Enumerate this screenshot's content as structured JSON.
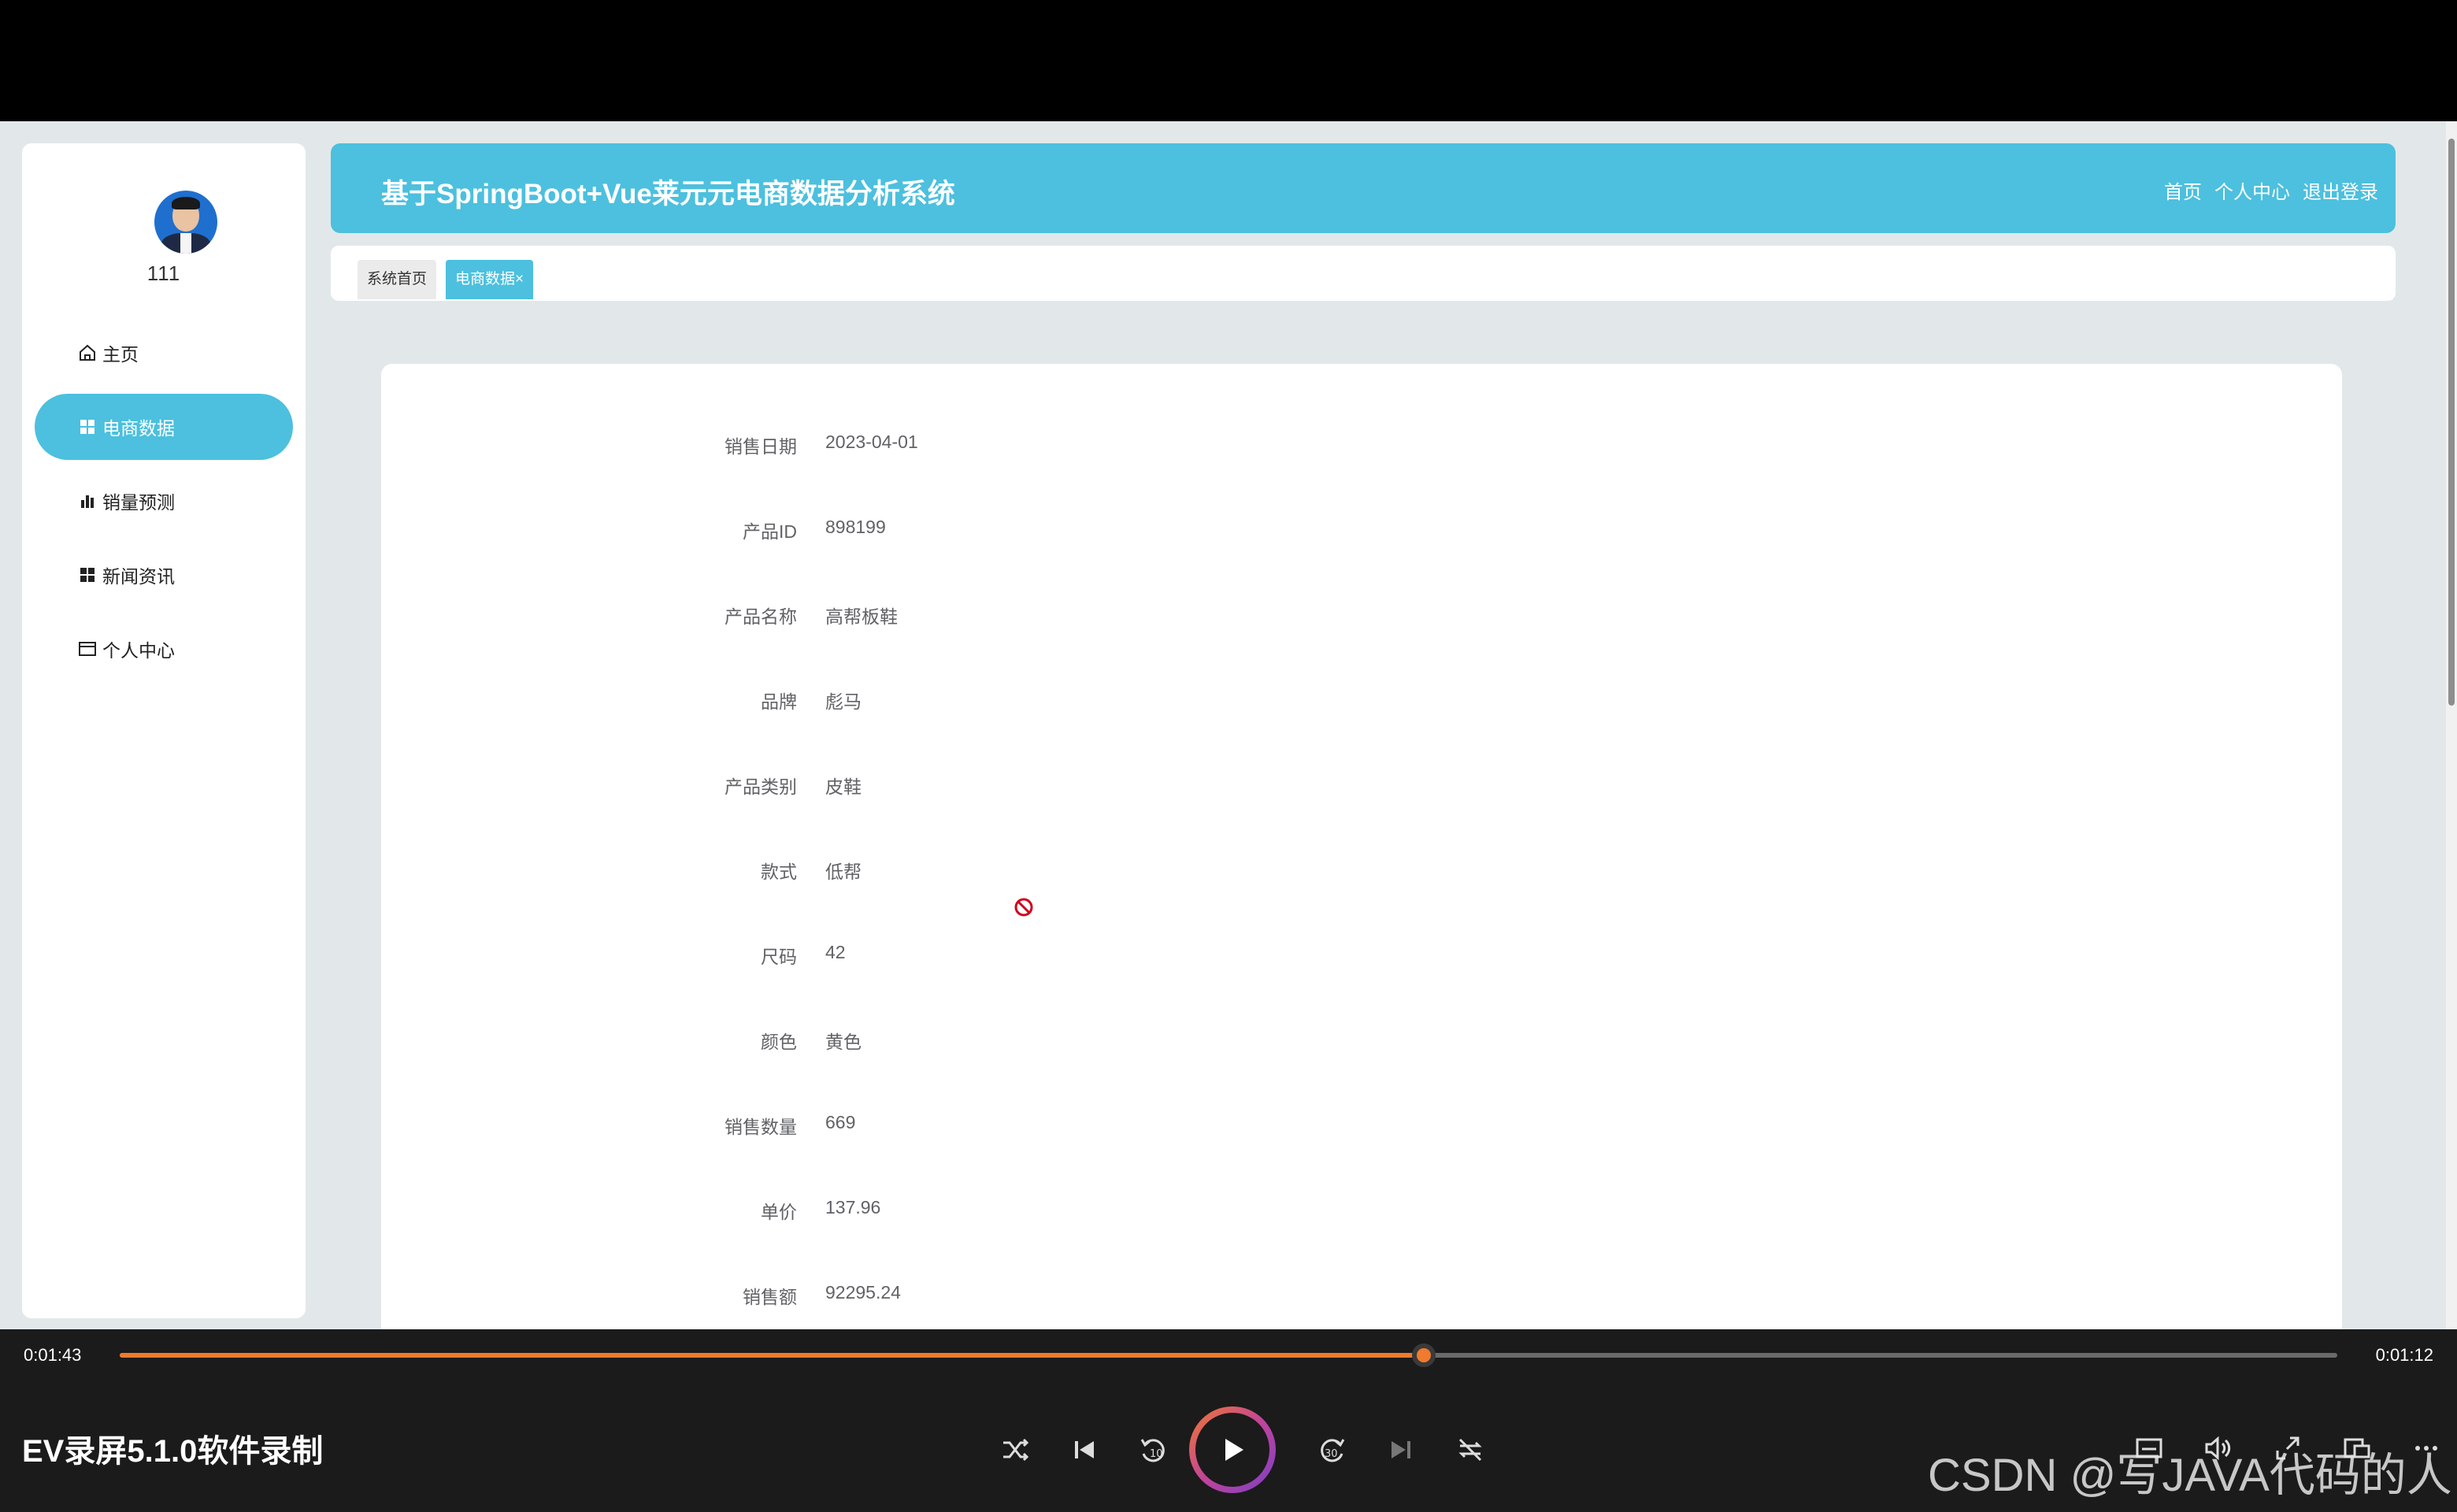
{
  "app": {
    "title": "基于SpringBoot+Vue莱元元电商数据分析系统",
    "accent_color": "#4cc0de"
  },
  "header_links": [
    {
      "label": "首页"
    },
    {
      "label": "个人中心"
    },
    {
      "label": "退出登录"
    }
  ],
  "user": {
    "name": "111"
  },
  "sidebar": {
    "items": [
      {
        "label": "主页",
        "icon": "home-icon",
        "active": false
      },
      {
        "label": "电商数据",
        "icon": "grid-icon",
        "active": true
      },
      {
        "label": "销量预测",
        "icon": "bar-chart-icon",
        "active": false
      },
      {
        "label": "新闻资讯",
        "icon": "grid-icon",
        "active": false
      },
      {
        "label": "个人中心",
        "icon": "card-icon",
        "active": false
      }
    ]
  },
  "tabs": [
    {
      "label": "系统首页"
    },
    {
      "label": "电商数据×"
    }
  ],
  "detail": {
    "fields": [
      {
        "label": "销售日期",
        "value": "2023-04-01"
      },
      {
        "label": "产品ID",
        "value": "898199"
      },
      {
        "label": "产品名称",
        "value": "高帮板鞋"
      },
      {
        "label": "品牌",
        "value": "彪马"
      },
      {
        "label": "产品类别",
        "value": "皮鞋"
      },
      {
        "label": "款式",
        "value": "低帮"
      },
      {
        "label": "尺码",
        "value": "42"
      },
      {
        "label": "颜色",
        "value": "黄色"
      },
      {
        "label": "销售数量",
        "value": "669"
      },
      {
        "label": "单价",
        "value": "137.96"
      },
      {
        "label": "销售额",
        "value": "92295.24"
      }
    ]
  },
  "player": {
    "elapsed": "0:01:43",
    "remaining": "0:01:12",
    "progress_fraction": 0.588,
    "caption": "EV录屏5.1.0软件录制",
    "watermark": "CSDN @写JAVA代码的人"
  }
}
